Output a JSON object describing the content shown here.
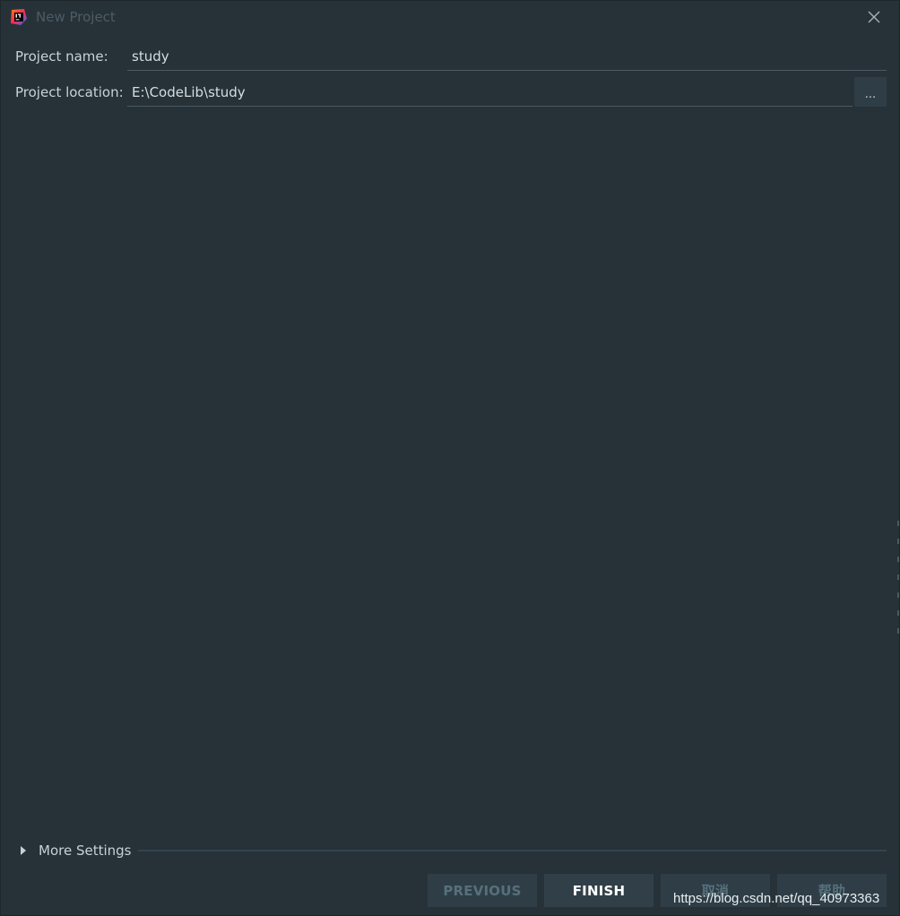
{
  "window": {
    "title": "New Project"
  },
  "form": {
    "project_name_label": "Project name:",
    "project_name_value": "study",
    "project_location_label": "Project location:",
    "project_location_value": "E:\\CodeLib\\study",
    "browse_label": "..."
  },
  "more_settings": {
    "label": "More Settings"
  },
  "buttons": {
    "previous": "PREVIOUS",
    "finish": "FINISH",
    "cancel": "取消",
    "help": "帮助"
  },
  "watermark": "https://blog.csdn.net/qq_40973363",
  "colors": {
    "background": "#263238",
    "button_bg": "#2f3e46",
    "disabled_text": "#56707c",
    "text": "#c9d1d6"
  },
  "icons": {
    "app": "intellij-idea-icon",
    "close": "close-icon",
    "expand": "triangle-right-icon"
  }
}
